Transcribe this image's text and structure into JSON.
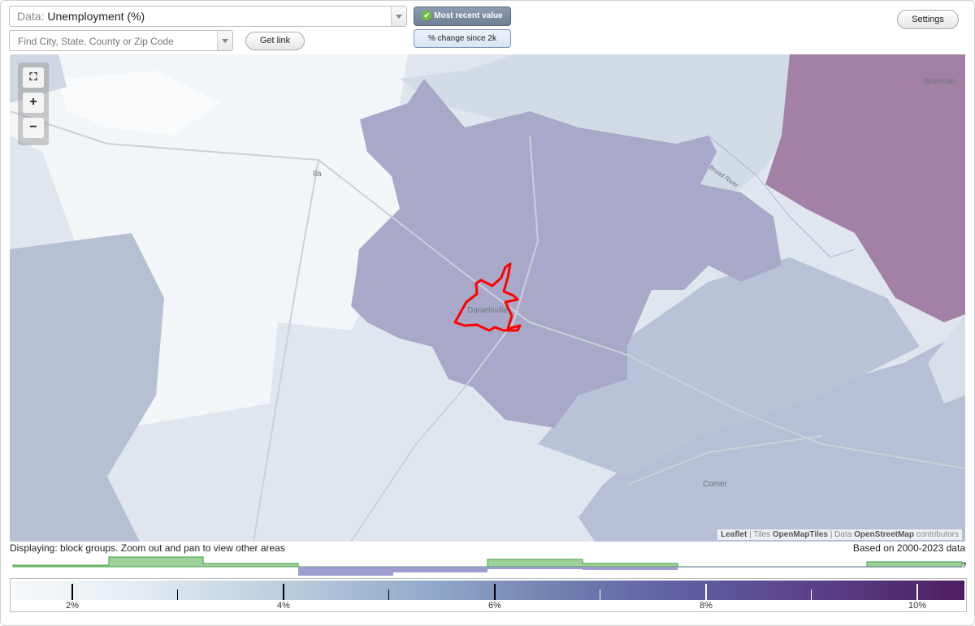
{
  "toolbar": {
    "data_prefix": "Data:",
    "data_value": "Unemployment (%)",
    "search_placeholder": "Find City, State, County or Zip Code",
    "get_link_label": "Get link",
    "toggle_recent_label": "Most recent value",
    "toggle_change_label": "% change since 2k",
    "settings_label": "Settings"
  },
  "map": {
    "place_labels": [
      "Bowman",
      "Ila",
      "Danielsville",
      "Comer"
    ],
    "road_label": "Broad River",
    "attribution": {
      "leaflet": "Leaflet",
      "sep1": " | Tiles ",
      "tiles": "OpenMapTiles",
      "sep2": " | Data ",
      "osm": "OpenStreetMap",
      "suffix": " contributors"
    },
    "highlight_color": "#ff0000"
  },
  "captions": {
    "displaying": "Displaying: block groups. Zoom out and pan to view other areas",
    "based_on": "Based on 2000-2023 data"
  },
  "legend": {
    "labels": [
      "2%",
      "4%",
      "6%",
      "8%",
      "10%"
    ],
    "help_mark": "?",
    "min": 1.0,
    "max": 11.0
  },
  "icons": [
    "fullscreen-icon",
    "zoom-in-icon",
    "zoom-out-icon",
    "checkmark-icon",
    "dropdown-arrow-icon"
  ]
}
